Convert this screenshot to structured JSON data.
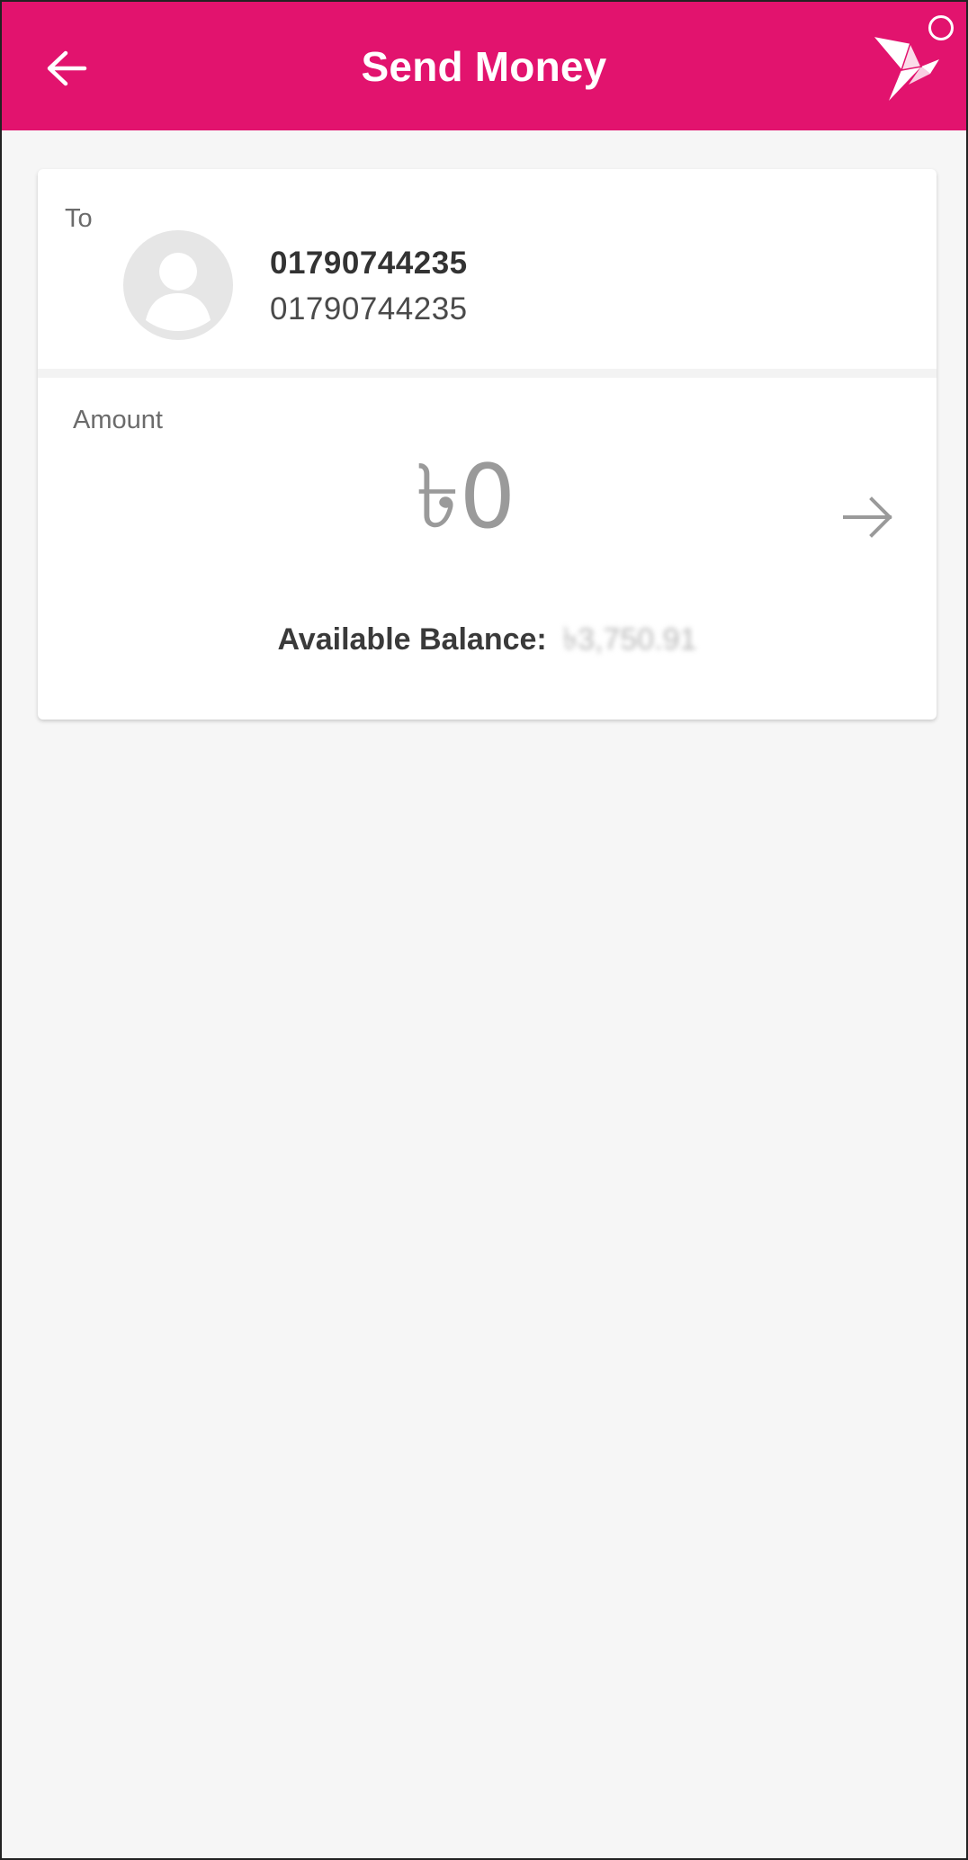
{
  "app_bar": {
    "title": "Send Money",
    "background_color": "#e2136e",
    "back_icon": "arrow-left-icon",
    "logo_icon": "origami-bird-logo-icon"
  },
  "recipient": {
    "label": "To",
    "name": "01790744235",
    "number": "01790744235",
    "avatar_icon": "user-avatar-icon"
  },
  "amount": {
    "label": "Amount",
    "value": "৳0",
    "next_icon": "arrow-right-icon"
  },
  "balance": {
    "label": "Available Balance:",
    "value": "৳3,750.91"
  }
}
